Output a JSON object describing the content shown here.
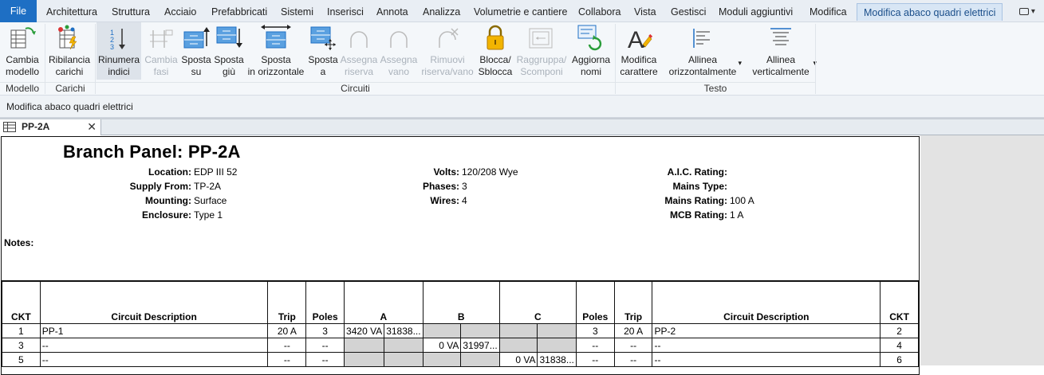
{
  "menu": {
    "file": "File",
    "tabs": [
      "Architettura",
      "Struttura",
      "Acciaio",
      "Prefabbricati",
      "Sistemi",
      "Inserisci",
      "Annota",
      "Analizza",
      "Volumetrie e cantiere",
      "Collabora",
      "Vista",
      "Gestisci",
      "Moduli aggiuntivi",
      "Modifica",
      "Modifica abaco quadri elettrici"
    ],
    "dropdown": "▾"
  },
  "ribbon": {
    "buttons": [
      {
        "id": "cambia-modello",
        "l1": "Cambia",
        "l2": "modello",
        "disabled": false
      },
      {
        "id": "ribilancia",
        "l1": "Ribilancia",
        "l2": "carichi",
        "disabled": false
      },
      {
        "id": "rinumera",
        "l1": "Rinumera",
        "l2": "indici",
        "disabled": false
      },
      {
        "id": "cambia-fasi",
        "l1": "Cambia",
        "l2": "fasi",
        "disabled": true
      },
      {
        "id": "sposta-su",
        "l1": "Sposta",
        "l2": "su",
        "disabled": false
      },
      {
        "id": "sposta-giu",
        "l1": "Sposta",
        "l2": "giù",
        "disabled": false
      },
      {
        "id": "sposta-orizz",
        "l1": "Sposta",
        "l2": "in orizzontale",
        "disabled": false
      },
      {
        "id": "sposta-a",
        "l1": "Sposta",
        "l2": "a",
        "disabled": false
      },
      {
        "id": "assegna-riserva",
        "l1": "Assegna",
        "l2": "riserva",
        "disabled": true
      },
      {
        "id": "assegna-vano",
        "l1": "Assegna",
        "l2": "vano",
        "disabled": true
      },
      {
        "id": "rimuovi",
        "l1": "Rimuovi",
        "l2": "riserva/vano",
        "disabled": true
      },
      {
        "id": "blocca",
        "l1": "Blocca/",
        "l2": "Sblocca",
        "disabled": false
      },
      {
        "id": "raggruppa",
        "l1": "Raggruppa/",
        "l2": "Scomponi",
        "disabled": true
      },
      {
        "id": "aggiorna",
        "l1": "Aggiorna",
        "l2": "nomi",
        "disabled": false
      },
      {
        "id": "modifica-carattere",
        "l1": "Modifica",
        "l2": "carattere",
        "disabled": false
      },
      {
        "id": "allinea-orizz",
        "l1": "Allinea",
        "l2": "orizzontalmente",
        "disabled": false
      },
      {
        "id": "allinea-vert",
        "l1": "Allinea",
        "l2": "verticalmente",
        "disabled": false
      }
    ],
    "groups": [
      "Modello",
      "Carichi",
      "Circuiti",
      "Testo"
    ]
  },
  "options_bar": "Modifica abaco quadri elettrici",
  "view_tab": {
    "title": "PP-2A",
    "close": "✕"
  },
  "panel": {
    "title": "Branch Panel: PP-2A",
    "left": [
      {
        "label": "Location:",
        "value": "EDP III 52"
      },
      {
        "label": "Supply From:",
        "value": "TP-2A"
      },
      {
        "label": "Mounting:",
        "value": "Surface"
      },
      {
        "label": "Enclosure:",
        "value": "Type 1"
      }
    ],
    "mid": [
      {
        "label": "Volts:",
        "value": "120/208 Wye"
      },
      {
        "label": "Phases:",
        "value": "3"
      },
      {
        "label": "Wires:",
        "value": "4"
      }
    ],
    "right": [
      {
        "label": "A.I.C. Rating:",
        "value": ""
      },
      {
        "label": "Mains Type:",
        "value": ""
      },
      {
        "label": "Mains Rating:",
        "value": "100 A"
      },
      {
        "label": "MCB Rating:",
        "value": "1 A"
      }
    ],
    "notes_label": "Notes:"
  },
  "table": {
    "headers": [
      "CKT",
      "Circuit Description",
      "Trip",
      "Poles",
      "A",
      "B",
      "C",
      "Poles",
      "Trip",
      "Circuit Description",
      "CKT"
    ],
    "rows": [
      {
        "ckt_l": "1",
        "desc_l": "PP-1",
        "trip_l": "20 A",
        "poles_l": "3",
        "a1": "3420 VA",
        "a2": "31838...",
        "b1": "",
        "b2": "",
        "c1": "",
        "c2": "",
        "poles_r": "3",
        "trip_r": "20 A",
        "desc_r": "PP-2",
        "ckt_r": "2"
      },
      {
        "ckt_l": "3",
        "desc_l": "--",
        "trip_l": "--",
        "poles_l": "--",
        "a1": "",
        "a2": "",
        "b1": "0 VA",
        "b2": "31997...",
        "c1": "",
        "c2": "",
        "poles_r": "--",
        "trip_r": "--",
        "desc_r": "--",
        "ckt_r": "4"
      },
      {
        "ckt_l": "5",
        "desc_l": "--",
        "trip_l": "--",
        "poles_l": "--",
        "a1": "",
        "a2": "",
        "b1": "",
        "b2": "",
        "c1": "0 VA",
        "c2": "31838...",
        "poles_r": "--",
        "trip_r": "--",
        "desc_r": "--",
        "ckt_r": "6"
      }
    ]
  },
  "colors": {
    "file_tab": "#1e6fc4",
    "active_tab": "#d8e6f5",
    "icon_blue": "#1e6fc4",
    "lock_yellow": "#f2b400",
    "refresh_green": "#2a9d3a",
    "shaded_cell": "#d3d3d3"
  }
}
